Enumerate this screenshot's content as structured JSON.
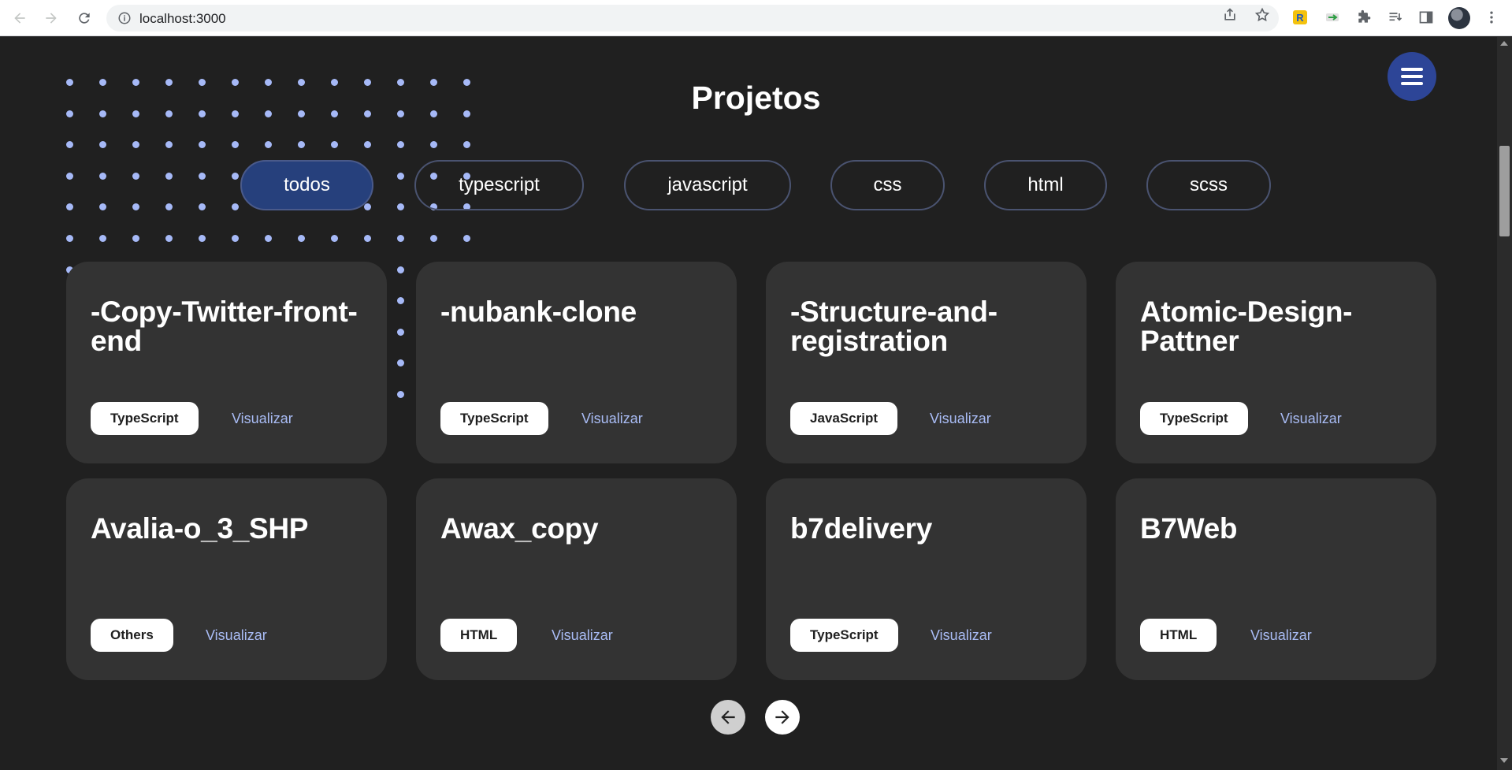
{
  "browser": {
    "url": "localhost:3000"
  },
  "page": {
    "title": "Projetos",
    "menu_icon": "hamburger-menu-icon",
    "filters": [
      {
        "label": "todos",
        "active": true
      },
      {
        "label": "typescript",
        "active": false
      },
      {
        "label": "javascript",
        "active": false
      },
      {
        "label": "css",
        "active": false
      },
      {
        "label": "html",
        "active": false
      },
      {
        "label": "scss",
        "active": false
      }
    ],
    "projects": [
      {
        "name": "-Copy-Twitter-front-end",
        "tech": "TypeScript",
        "action": "Visualizar"
      },
      {
        "name": "-nubank-clone",
        "tech": "TypeScript",
        "action": "Visualizar"
      },
      {
        "name": "-Structure-and-registration",
        "tech": "JavaScript",
        "action": "Visualizar"
      },
      {
        "name": "Atomic-Design-Pattner",
        "tech": "TypeScript",
        "action": "Visualizar"
      },
      {
        "name": "Avalia-o_3_SHP",
        "tech": "Others",
        "action": "Visualizar"
      },
      {
        "name": "Awax_copy",
        "tech": "HTML",
        "action": "Visualizar"
      },
      {
        "name": "b7delivery",
        "tech": "TypeScript",
        "action": "Visualizar"
      },
      {
        "name": "B7Web",
        "tech": "HTML",
        "action": "Visualizar"
      }
    ],
    "pagination": {
      "prev_icon": "arrow-left-icon",
      "next_icon": "arrow-right-icon"
    }
  },
  "colors": {
    "background": "#202020",
    "card": "#333333",
    "accent": "#2d4597",
    "link": "#a9bcf5",
    "dots": "#a6b9f7"
  }
}
